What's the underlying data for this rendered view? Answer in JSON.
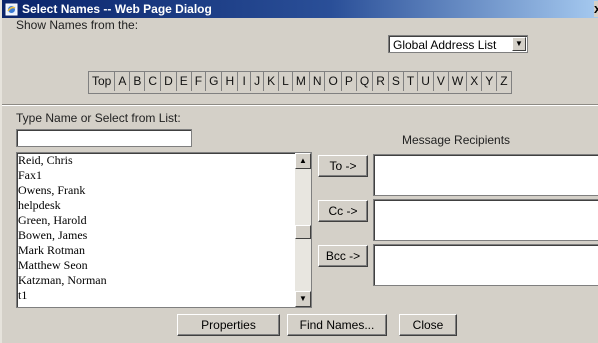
{
  "window": {
    "title": "Select Names -- Web Page Dialog",
    "title_icon": "ie-page-icon",
    "close_glyph": "x"
  },
  "address_source": {
    "label": "Show Names from the:",
    "selected": "Global Address List"
  },
  "alphabet": [
    "Top",
    "A",
    "B",
    "C",
    "D",
    "E",
    "F",
    "G",
    "H",
    "I",
    "J",
    "K",
    "L",
    "M",
    "N",
    "O",
    "P",
    "Q",
    "R",
    "S",
    "T",
    "U",
    "V",
    "W",
    "X",
    "Y",
    "Z"
  ],
  "search": {
    "label": "Type Name or Select from List:",
    "value": ""
  },
  "names": [
    "Reid, Chris",
    "Fax1",
    "Owens, Frank",
    "helpdesk",
    "Green, Harold",
    "Bowen, James",
    "Mark Rotman",
    "Matthew Seon",
    "Katzman, Norman",
    "t1"
  ],
  "recipients": {
    "label": "Message Recipients",
    "to_label": "To ->",
    "cc_label": "Cc ->",
    "bcc_label": "Bcc ->"
  },
  "footer": {
    "properties_label": "Properties",
    "find_label": "Find Names...",
    "close_label": "Close"
  }
}
